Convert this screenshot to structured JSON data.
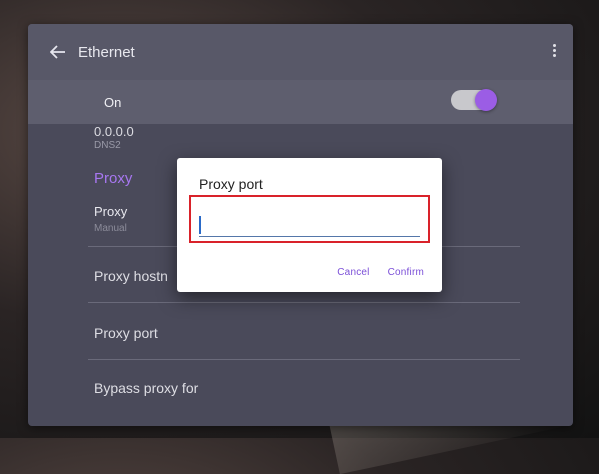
{
  "appbar": {
    "title": "Ethernet",
    "back_icon": "arrow-left-icon",
    "menu_icon": "more-vertical-icon"
  },
  "master": {
    "label": "On",
    "enabled": true,
    "accent": "#9b5de5"
  },
  "settings": {
    "dns2_value": "0.0.0.0",
    "dns2_label": "DNS2",
    "section_proxy": "Proxy",
    "proxy_title": "Proxy",
    "proxy_mode": "Manual",
    "hostname_label": "Proxy hostn",
    "port_label": "Proxy port",
    "bypass_label": "Bypass proxy for"
  },
  "dialog": {
    "title": "Proxy port",
    "input_value": "",
    "cancel_label": "Cancel",
    "confirm_label": "Confirm"
  },
  "colors": {
    "accent": "#a777f0",
    "highlight": "#d9222a",
    "panel": "#4a4a5a"
  }
}
